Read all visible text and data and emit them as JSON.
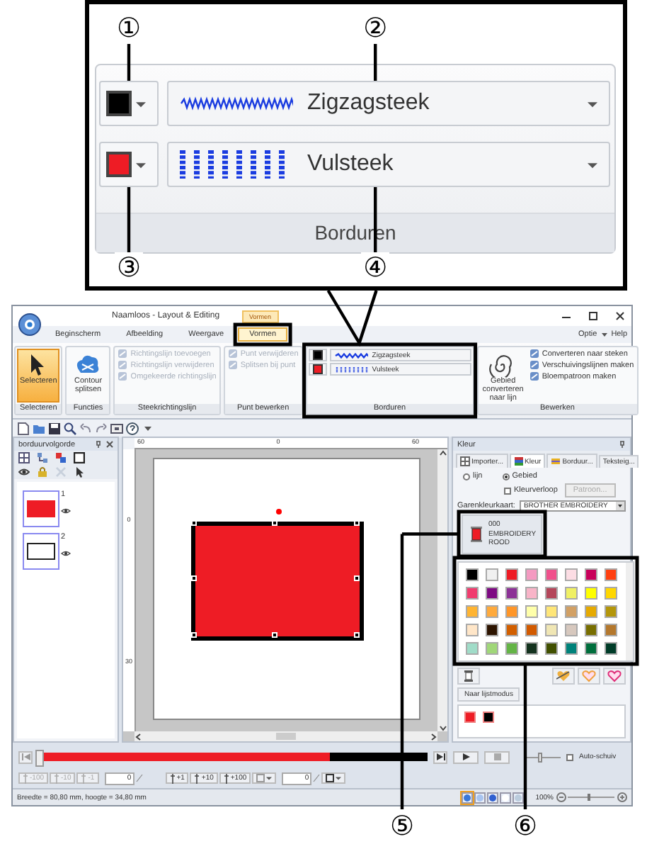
{
  "callout": {
    "rows": [
      {
        "kind": "zigzag",
        "color": "#000000",
        "stitch": "Zigzagsteek"
      },
      {
        "kind": "fill",
        "color": "#ee1c25",
        "stitch": "Vulsteek"
      }
    ],
    "group_label": "Borduren"
  },
  "markers": [
    "①",
    "②",
    "③",
    "④",
    "⑤",
    "⑥"
  ],
  "window": {
    "title": "Naamloos - Layout & Editing",
    "context_tab": "Vormen"
  },
  "tabs": [
    {
      "label": "Beginscherm",
      "selected": false
    },
    {
      "label": "Afbeelding",
      "selected": false
    },
    {
      "label": "Weergave",
      "selected": false
    },
    {
      "label": "Vormen",
      "selected": true
    }
  ],
  "help_links": [
    "Optie",
    "Help"
  ],
  "ribbon": {
    "groups": [
      {
        "label": "Selecteren",
        "items": [
          {
            "kind": "large",
            "label": "Selecteren",
            "active": true
          }
        ]
      },
      {
        "label": "Functies",
        "items": [
          {
            "kind": "large",
            "label": "Contour splitsen",
            "active": false
          }
        ]
      },
      {
        "label": "Steekrichtingslijn",
        "items": [
          {
            "kind": "small",
            "label": "Richtingslijn toevoegen",
            "disabled": true
          },
          {
            "kind": "small",
            "label": "Richtingslijn verwijderen",
            "disabled": true
          },
          {
            "kind": "small",
            "label": "Omgekeerde richtingslijn",
            "disabled": true
          }
        ]
      },
      {
        "label": "Punt bewerken",
        "items": [
          {
            "kind": "small",
            "label": "Punt verwijderen",
            "disabled": true
          },
          {
            "kind": "small",
            "label": "Splitsen bij punt",
            "disabled": true
          }
        ]
      },
      {
        "label": "Borduren",
        "items": [
          {
            "kind": "zigzag",
            "color": "#000000",
            "stitch": "Zigzagsteek"
          },
          {
            "kind": "fill",
            "color": "#ee1c25",
            "stitch": "Vulsteek"
          }
        ]
      },
      {
        "label": "Bewerken",
        "items": [
          {
            "kind": "large",
            "label": "Gebied converteren naar lijn",
            "active": false
          },
          {
            "kind": "small",
            "label": "Converteren naar steken",
            "disabled": false
          },
          {
            "kind": "small",
            "label": "Verschuivingslijnen maken",
            "disabled": false
          },
          {
            "kind": "small",
            "label": "Bloempatroon maken",
            "disabled": false
          }
        ]
      }
    ]
  },
  "sequence_panel": {
    "title": "borduurvolgorde",
    "items": [
      {
        "number": "1",
        "kind": "fill"
      },
      {
        "number": "2",
        "kind": "line"
      }
    ]
  },
  "canvas": {
    "ruler_labels": [
      "60",
      "0",
      "60"
    ],
    "side_ruler_labels": [
      "0",
      "30"
    ]
  },
  "color_panel": {
    "title": "Kleur",
    "tabs": [
      {
        "label": "Importer...",
        "selected": false
      },
      {
        "label": "Kleur",
        "selected": true
      },
      {
        "label": "Borduur...",
        "selected": false
      },
      {
        "label": "Teksteig...",
        "selected": false
      }
    ],
    "radios": [
      {
        "label": "lijn",
        "selected": false
      },
      {
        "label": "Gebied",
        "selected": true
      }
    ],
    "gradient": {
      "label": "Kleurverloop",
      "checked": false
    },
    "pattern_button": {
      "label": "Patroon...",
      "disabled": true
    },
    "chart_label": "Garenkleurkaart:",
    "chart_value": "BROTHER EMBROIDERY",
    "current": {
      "code": "000",
      "name": "EMBROIDERY ROOD",
      "color": "#ee1c25"
    },
    "palette": [
      {
        "color": "#000000"
      },
      {
        "color": "#f0f0f0"
      },
      {
        "color": "#ee1c25"
      },
      {
        "color": "#f49ac1"
      },
      {
        "color": "#f0508c"
      },
      {
        "color": "#fcdde4"
      },
      {
        "color": "#c8005a"
      },
      {
        "color": "#ff4010"
      },
      {
        "color": "#f03c6e"
      },
      {
        "color": "#7d0a82"
      },
      {
        "color": "#8c3296"
      },
      {
        "color": "#f8b4c8"
      },
      {
        "color": "#b4465a"
      },
      {
        "color": "#f0f064"
      },
      {
        "color": "#ffff00"
      },
      {
        "color": "#ffd700"
      },
      {
        "color": "#ffb432"
      },
      {
        "color": "#ffaa3c"
      },
      {
        "color": "#ff9628"
      },
      {
        "color": "#ffffaa"
      },
      {
        "color": "#ffe678"
      },
      {
        "color": "#d2a064"
      },
      {
        "color": "#e6aa00"
      },
      {
        "color": "#b4960a"
      },
      {
        "color": "#ffe6c8"
      },
      {
        "color": "#2d1400"
      },
      {
        "color": "#d25f00"
      },
      {
        "color": "#d25a00"
      },
      {
        "color": "#f0e6b4"
      },
      {
        "color": "#d7c8be"
      },
      {
        "color": "#786e00"
      },
      {
        "color": "#b4782d"
      },
      {
        "color": "#a0dcc8"
      },
      {
        "color": "#a0d778"
      },
      {
        "color": "#64b446"
      },
      {
        "color": "#14321e"
      },
      {
        "color": "#415000"
      },
      {
        "color": "#00827a"
      },
      {
        "color": "#006e3c"
      },
      {
        "color": "#003c28"
      }
    ],
    "list_mode_button": "Naar lijstmodus",
    "used_colors": [
      {
        "color": "#ee1c25"
      },
      {
        "color": "#000000"
      }
    ]
  },
  "playback": {
    "level": 0.75,
    "speed": {
      "level": 0.45
    },
    "auto_scroll": {
      "label": "Auto-schuiv",
      "checked": false
    }
  },
  "steps": {
    "back": [
      {
        "label": "-100",
        "disabled": true
      },
      {
        "label": "-10",
        "disabled": true
      },
      {
        "label": "-1",
        "disabled": true
      }
    ],
    "back_value": "0",
    "forward": [
      {
        "label": "+1",
        "disabled": false
      },
      {
        "label": "+10",
        "disabled": false
      },
      {
        "label": "+100",
        "disabled": false
      }
    ],
    "forward_value": "0"
  },
  "status_bar": {
    "text": "Breedte = 80,80 mm, hoogte = 34,80 mm",
    "zoom": "100%"
  }
}
